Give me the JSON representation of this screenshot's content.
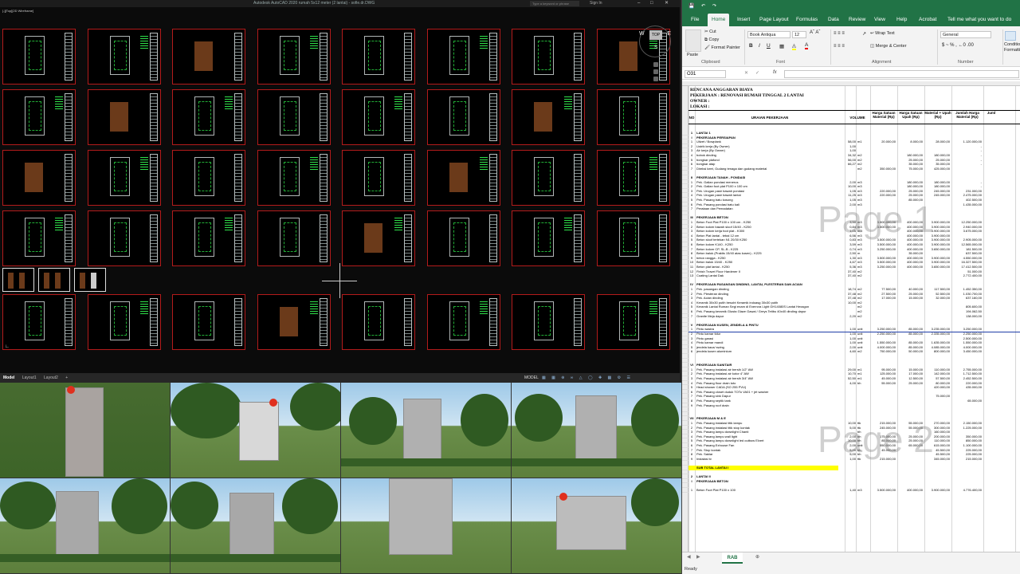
{
  "autocad": {
    "title": "Autodesk AutoCAD 2020    rumah 5x12 meter (2 lantai) - sofie.dr.DWG",
    "search_placeholder": "Type a keyword or phrase",
    "sign_in": "Sign In",
    "viewport_label": "[-][Top][2D Wireframe]",
    "viewcube": {
      "top": "TOP",
      "w": "W",
      "e": "E",
      "s": "S"
    },
    "layout_tabs": [
      "Model",
      "Layout1",
      "Layout2"
    ],
    "status_model": "MODEL"
  },
  "excel": {
    "title_app": "Excel",
    "ribbon_tabs": [
      "File",
      "Home",
      "Insert",
      "Page Layout",
      "Formulas",
      "Data",
      "Review",
      "View",
      "Help",
      "Acrobat",
      "Tell me what you want to do"
    ],
    "clipboard": {
      "paste": "Paste",
      "cut": "Cut",
      "copy": "Copy",
      "format_painter": "Format Painter",
      "group": "Clipboard"
    },
    "font": {
      "name": "Book Antiqua",
      "size": "12",
      "group": "Font"
    },
    "alignment": {
      "wrap": "Wrap Text",
      "merge": "Merge & Center",
      "group": "Alignment"
    },
    "number": {
      "format": "General",
      "group": "Number"
    },
    "conditional": "Conditional Formatting",
    "namebox": "O31",
    "fx": "fx",
    "doc_header": {
      "line1": "RENCANA ANGGARAN BIAYA",
      "line2": "PEKERJAAN : RENOVASI RUMAH TINGGAL 2 LANTAI",
      "line3": "OWNER      :",
      "line4": "LOKASI     :"
    },
    "columns": [
      "NO",
      "URAIAN PEKERJAAN",
      "VOLUME",
      "Harga Satuan Material (Rp)",
      "Harga Satuan Upah (Rp)",
      "Material + Upah (Rp)",
      "Jumlah Harga Material (Rp)",
      "Juml"
    ],
    "rows": [
      {
        "no": "1",
        "desc": "LANTAI 1",
        "cls": "sec"
      },
      {
        "no": "I",
        "desc": "PEKERJAAN PERSIAPAN",
        "cls": "sec"
      },
      {
        "no": "1",
        "desc": "Uitzet / Bowplank",
        "vol": "58,00",
        "sat": "m1",
        "hm": "20.000,00",
        "hu": "8.000,00",
        "mu": "28.000,00",
        "jm": "1.120.000,00"
      },
      {
        "no": "2",
        "desc": "Listrik kerja (By Owner)",
        "vol": "1,00",
        "sat": "",
        "hm": "",
        "hu": "",
        "mu": "",
        "jm": "-"
      },
      {
        "no": "3",
        "desc": "Air kerja (By Owner)",
        "vol": "1,00",
        "sat": "",
        "hm": "",
        "hu": "",
        "mu": "",
        "jm": "-"
      },
      {
        "no": "4",
        "desc": "bobok dinding",
        "vol": "34,32",
        "sat": "m2",
        "hm": "",
        "hu": "180.000,00",
        "mu": "180.000,00",
        "jm": "-"
      },
      {
        "no": "5",
        "desc": "bongkar plafond",
        "vol": "56,00",
        "sat": "m2",
        "hm": "",
        "hu": "25.000,00",
        "mu": "25.000,00",
        "jm": "-"
      },
      {
        "no": "6",
        "desc": "bongkar atap",
        "vol": "66,27",
        "sat": "m2",
        "hm": "",
        "hu": "35.000,00",
        "mu": "35.000,00",
        "jm": "-"
      },
      {
        "no": "7",
        "desc": "Direksi keet, Gudang tenaga dan gudang material",
        "vol": "",
        "sat": "m2",
        "hm": "350.000,00",
        "hu": "75.000,00",
        "mu": "425.000,00",
        "jm": ""
      },
      {
        "no": "",
        "desc": "",
        "cls": "blank"
      },
      {
        "no": "II",
        "desc": "PEKERJAAN TANAH - PONDASI",
        "cls": "sec"
      },
      {
        "no": "1",
        "desc": "Pek. Galian pondasi menerus",
        "vol": "2,00",
        "sat": "m3",
        "hm": "",
        "hu": "180.000,00",
        "mu": "180.000,00",
        "jm": "-"
      },
      {
        "no": "2",
        "desc": "Pek. Galian foot plat P100 x 100 cm",
        "vol": "10,00",
        "sat": "m3",
        "hm": "",
        "hu": "180.000,00",
        "mu": "180.000,00",
        "jm": "-"
      },
      {
        "no": "3",
        "desc": "Pek. Urugan pasir bawah pondasi",
        "vol": "1,05",
        "sat": "m3",
        "hm": "220.000,00",
        "hu": "25.000,00",
        "mu": "245.000,00",
        "jm": "231.000,00"
      },
      {
        "no": "4",
        "desc": "Pek. Urugan pasir bawah lantai",
        "vol": "11,25",
        "sat": "m3",
        "hm": "220.000,00",
        "hu": "25.000,00",
        "mu": "245.000,00",
        "jm": "2.475.000,00"
      },
      {
        "no": "5",
        "desc": "Pek. Pasang batu kosong",
        "vol": "1,05",
        "sat": "m3",
        "hm": "",
        "hu": "85.000,00",
        "mu": "",
        "jm": "402.500,00"
      },
      {
        "no": "6",
        "desc": "Pek. Pasang pondasi batu kali",
        "vol": "2,00",
        "sat": "m3",
        "hm": "",
        "hu": "",
        "mu": "",
        "jm": "1.435.000,00"
      },
      {
        "no": "7",
        "desc": "Perataan dan Pemadatan",
        "vol": "",
        "sat": "",
        "hm": "",
        "hu": "",
        "mu": "",
        "jm": ""
      },
      {
        "no": "",
        "desc": "",
        "cls": "blank"
      },
      {
        "no": "III",
        "desc": "PEKERJAAN BETON",
        "cls": "sec"
      },
      {
        "no": "1",
        "desc": "Beton Foot Plat P100 x 100 cm - K250",
        "vol": "3,50",
        "sat": "m3",
        "hm": "3.500.000,00",
        "hu": "400.000,00",
        "mu": "3.900.000,00",
        "jm": "12.250.000,00"
      },
      {
        "no": "2",
        "desc": "Beton kolom bawah sloof 15/40 - K250",
        "vol": "0,84",
        "sat": "m3",
        "hm": "3.500.000,00",
        "hu": "400.000,00",
        "mu": "3.900.000,00",
        "jm": "2.940.000,00"
      },
      {
        "no": "3",
        "desc": "Beton kolom kerja foot plat - K300",
        "vol": "1,05",
        "sat": "m3",
        "hm": "",
        "hu": "400.000,00",
        "mu": "3.900.000,00",
        "jm": "3.675.000,00"
      },
      {
        "no": "4",
        "desc": "Beton Plat lantai - tebal 12 cm",
        "vol": "6,56",
        "sat": "m3",
        "hm": "",
        "hu": "400.000,00",
        "mu": "3.900.000,00",
        "jm": ""
      },
      {
        "no": "5",
        "desc": "Beton sloof tertekan N1 20/30 K250",
        "vol": "0,83",
        "sat": "m3",
        "hm": "3.500.000,00",
        "hu": "400.000,00",
        "mu": "3.900.000,00",
        "jm": "2.905.000,00"
      },
      {
        "no": "6",
        "desc": "Beton kolom K140 - K250",
        "vol": "3,59",
        "sat": "m3",
        "hm": "3.500.000,00",
        "hu": "400.000,00",
        "mu": "3.900.000,00",
        "jm": "12.565.000,00"
      },
      {
        "no": "7",
        "desc": "Beton kolom CP, SL-B - K225",
        "vol": "0,74",
        "sat": "m3",
        "hm": "3.250.000,00",
        "hu": "400.000,00",
        "mu": "3.650.000,00",
        "jm": "181.500,00"
      },
      {
        "no": "8",
        "desc": "Beton balok (Praktis 15/40 atas kusen) - K225",
        "vol": "2,50",
        "sat": "m",
        "hm": "",
        "hu": "35.000,00",
        "mu": "",
        "jm": "637.500,00"
      },
      {
        "no": "9",
        "desc": "beton rangga - K250",
        "vol": "1,30",
        "sat": "m3",
        "hm": "3.500.000,00",
        "hu": "400.000,00",
        "mu": "3.900.000,00",
        "jm": "4.550.000,00"
      },
      {
        "no": "10",
        "desc": "Beton balok 15/40 - K250",
        "vol": "4,67",
        "sat": "m3",
        "hm": "3.500.000,00",
        "hu": "400.000,00",
        "mu": "3.900.000,00",
        "jm": "16.327.500,00"
      },
      {
        "no": "11",
        "desc": "Beton plat lantai - K250",
        "vol": "5,36",
        "sat": "m3",
        "hm": "3.250.000,00",
        "hu": "400.000,00",
        "mu": "3.650.000,00",
        "jm": "17.412.500,00"
      },
      {
        "no": "12",
        "desc": "Finish Trowel Floor Hardener II",
        "vol": "37,40",
        "sat": "m2",
        "hm": "",
        "hu": "",
        "mu": "",
        "jm": "51.000,00"
      },
      {
        "no": "13",
        "desc": "Coating Lantai Dak",
        "vol": "37,40",
        "sat": "m2",
        "hm": "",
        "hu": "",
        "mu": "",
        "jm": "2.772.400,00"
      },
      {
        "no": "",
        "desc": "",
        "cls": "blank"
      },
      {
        "no": "IV",
        "desc": "PEKERJAAN PASANGAN DINDING, LANTAI, PLESTERAN DAN ACIAN",
        "cls": "sec"
      },
      {
        "no": "1",
        "desc": "Pek. pasangan dinding",
        "vol": "18,74",
        "sat": "m2",
        "hm": "77.500,00",
        "hu": "40.000,00",
        "mu": "117.500,00",
        "jm": "1.452.350,00"
      },
      {
        "no": "2",
        "desc": "Pek. Plesteran dinding",
        "vol": "37,48",
        "sat": "m2",
        "hm": "27.500,00",
        "hu": "25.000,00",
        "mu": "52.500,00",
        "jm": "1.030.700,00"
      },
      {
        "no": "3",
        "desc": "Pek. Acian dinding",
        "vol": "37,48",
        "sat": "m2",
        "hm": "17.000,00",
        "hu": "15.000,00",
        "mu": "32.000,00",
        "jm": "637.160,00"
      },
      {
        "no": "4",
        "desc": "Keramik 30x30 putih besobt Keramik indoasg 30x30 putih",
        "vol": "10,00",
        "sat": "m2",
        "hm": "",
        "hu": "",
        "mu": "",
        "jm": ""
      },
      {
        "no": "5",
        "desc": "Keramik Lantai Ruman Segi enam di Exerrcra Light GH14080S Lantai Hexagon",
        "vol": "",
        "sat": "m2",
        "hm": "",
        "hu": "",
        "mu": "",
        "jm": "805.600,00"
      },
      {
        "no": "6",
        "desc": "Pek. Pasang keramik Glusta Glaze Gawai / Greys Tetibu 40x40 dinding dapur",
        "vol": "",
        "sat": "m2",
        "hm": "",
        "hu": "",
        "mu": "",
        "jm": "194.062,50"
      },
      {
        "no": "7",
        "desc": "Granite Meja dapur",
        "vol": "2,20",
        "sat": "m2",
        "hm": "",
        "hu": "",
        "mu": "",
        "jm": "138.000,00"
      },
      {
        "no": "",
        "desc": "",
        "cls": "blank"
      },
      {
        "no": "V",
        "desc": "PEKERJAAN KUSEN, JENDELA & PINTU",
        "cls": "sec"
      },
      {
        "no": "1",
        "desc": "Pintu wastra",
        "vol": "1,00",
        "sat": "unit",
        "hm": "3.250.000,00",
        "hu": "85.000,00",
        "mu": "3.235.000,00",
        "jm": "3.250.000,00"
      },
      {
        "no": "2",
        "desc": "Pintu kamar tidur",
        "vol": "1,00",
        "sat": "unit",
        "hm": "2.250.000,00",
        "hu": "85.000,00",
        "mu": "2.335.000,00",
        "jm": "2.250.000,00"
      },
      {
        "no": "3",
        "desc": "Pintu garasi",
        "vol": "1,00",
        "sat": "unit",
        "hm": "",
        "hu": "",
        "mu": "",
        "jm": "2.500.000,00"
      },
      {
        "no": "4",
        "desc": "Pintu kamar mandi",
        "vol": "1,00",
        "sat": "unit",
        "hm": "1.550.000,00",
        "hu": "85.000,00",
        "mu": "1.635.000,00",
        "jm": "1.550.000,00"
      },
      {
        "no": "5",
        "desc": "jendela kaca/ swing",
        "vol": "2,00",
        "sat": "unit",
        "hm": "4.000.000,00",
        "hu": "85.000,00",
        "mu": "4.085.000,00",
        "jm": "4.000.000,00"
      },
      {
        "no": "6",
        "desc": "jendela kusen aluminium",
        "vol": "4,60",
        "sat": "m2",
        "hm": "750.000,00",
        "hu": "50.000,00",
        "mu": "800.000,00",
        "jm": "3.450.000,00"
      },
      {
        "no": "",
        "desc": "",
        "cls": "blank"
      },
      {
        "no": "",
        "desc": "",
        "cls": "blank"
      },
      {
        "no": "VI",
        "desc": "PEKERJAAN SANITAIR",
        "cls": "sec"
      },
      {
        "no": "1",
        "desc": "Pek. Pasang instalasi air bersih 1/2\" AW",
        "vol": "29,00",
        "sat": "m1",
        "hm": "95.000,00",
        "hu": "15.000,00",
        "mu": "110.000,00",
        "jm": "2.755.000,00"
      },
      {
        "no": "2",
        "desc": "Pek. Pasang instalasi air kotor 4\" AW",
        "vol": "10,70",
        "sat": "m1",
        "hm": "125.000,00",
        "hu": "17.000,00",
        "mu": "142.000,00",
        "jm": "1.712.500,00"
      },
      {
        "no": "3",
        "desc": "Pek. Pasang instalasi air bersih 3/4\" AW",
        "vol": "52,50",
        "sat": "m1",
        "hm": "45.000,00",
        "hu": "12.500,00",
        "mu": "57.500,00",
        "jm": "2.452.500,00"
      },
      {
        "no": "4",
        "desc": "Pek. Pasang floor drain toto",
        "vol": "4,00",
        "sat": "bh",
        "hm": "55.000,00",
        "hu": "25.000,00",
        "mu": "80.000,00",
        "jm": "220.000,00"
      },
      {
        "no": "5",
        "desc": "Head shower CADA (SO 255 PVU)",
        "vol": "",
        "sat": "",
        "hm": "",
        "hu": "",
        "mu": "420.000,00",
        "jm": "435.000,00"
      },
      {
        "no": "6",
        "desc": "Pek. Pasang closet duduk TOTo VA01 + jet washer",
        "vol": "",
        "sat": "",
        "hm": "",
        "hu": "",
        "mu": "",
        "jm": ""
      },
      {
        "no": "7",
        "desc": "Pek. Pasang sink Dapur",
        "vol": "",
        "sat": "",
        "hm": "",
        "hu": "",
        "mu": "75.000,00",
        "jm": ""
      },
      {
        "no": "8",
        "desc": "Pek. Pasang septik tank",
        "vol": "",
        "sat": "",
        "hm": "",
        "hu": "",
        "mu": "",
        "jm": "65.000,00"
      },
      {
        "no": "9",
        "desc": "Pek. Pasang roof drain",
        "vol": "",
        "sat": "",
        "hm": "",
        "hu": "",
        "mu": "",
        "jm": ""
      },
      {
        "no": "",
        "desc": "",
        "cls": "blank"
      },
      {
        "no": "",
        "desc": "",
        "cls": "blank"
      },
      {
        "no": "VII",
        "desc": "PEKERJAAN M & E",
        "cls": "sec"
      },
      {
        "no": "1",
        "desc": "Pek. Pasang instalasi titik lampu",
        "vol": "10,00",
        "sat": "ttk",
        "hm": "215.000,00",
        "hu": "55.000,00",
        "mu": "270.000,00",
        "jm": "2.150.000,00"
      },
      {
        "no": "2",
        "desc": "Pek. Pasang instalasi titik stop kontak",
        "vol": "5,00",
        "sat": "ttk",
        "hm": "245.000,00",
        "hu": "55.000,00",
        "mu": "300.000,00",
        "jm": "1.225.000,00"
      },
      {
        "no": "3",
        "desc": "Pek. Pasang lampu downlight Chanti",
        "vol": "",
        "sat": "bh",
        "hm": "",
        "hu": "",
        "mu": "160.000,00",
        "jm": ""
      },
      {
        "no": "4",
        "desc": "Pek. Pasang lampu wall light",
        "vol": "2,00",
        "sat": "bh",
        "hm": "175.000,00",
        "hu": "25.000,00",
        "mu": "200.000,00",
        "jm": "350.000,00"
      },
      {
        "no": "5",
        "desc": "Pek. Pasang lampu downlight led outbow Elvert",
        "vol": "10,00",
        "sat": "bh",
        "hm": "85.000,00",
        "hu": "25.000,00",
        "mu": "110.000,00",
        "jm": "850.000,00"
      },
      {
        "no": "6",
        "desc": "Pek. Pasang Exhouse Fan",
        "vol": "2,00",
        "sat": "unit",
        "hm": "550.000,00",
        "hu": "65.000,00",
        "mu": "615.000,00",
        "jm": "1.100.000,00"
      },
      {
        "no": "7",
        "desc": "Pek. Stop kontak",
        "vol": "5,00",
        "sat": "bh",
        "hm": "45.000,00",
        "hu": "",
        "mu": "45.500,00",
        "jm": "225.000,00"
      },
      {
        "no": "8",
        "desc": "Pek. Saklar",
        "vol": "5,00",
        "sat": "bh",
        "hm": "",
        "hu": "",
        "mu": "45.500,00",
        "jm": "225.000,00"
      },
      {
        "no": "9",
        "desc": "Instalasi tv",
        "vol": "1,00",
        "sat": "ttk",
        "hm": "215.000,00",
        "hu": "",
        "mu": "345.000,00",
        "jm": "215.000,00"
      },
      {
        "no": "",
        "desc": "",
        "cls": "blank"
      },
      {
        "no": "",
        "desc": "SUB TOTAL LANTAI I",
        "cls": "sub"
      },
      {
        "no": "",
        "desc": "",
        "cls": "blank"
      },
      {
        "no": "2",
        "desc": "LANTAI II",
        "cls": "sec"
      },
      {
        "no": "I",
        "desc": "PEKERJAAN BETON",
        "cls": "sec"
      },
      {
        "no": "",
        "desc": "",
        "cls": "blank"
      },
      {
        "no": "1",
        "desc": "Beton Foot Plat P100 x 100",
        "vol": "1,40",
        "sat": "m3",
        "hm": "3.500.000,00",
        "hu": "400.000,00",
        "mu": "3.900.000,00",
        "jm": "4.776.400,00"
      }
    ],
    "watermark1": "Page 1",
    "watermark2": "Page 2",
    "sheet_tab": "RAB",
    "status": "Ready"
  }
}
